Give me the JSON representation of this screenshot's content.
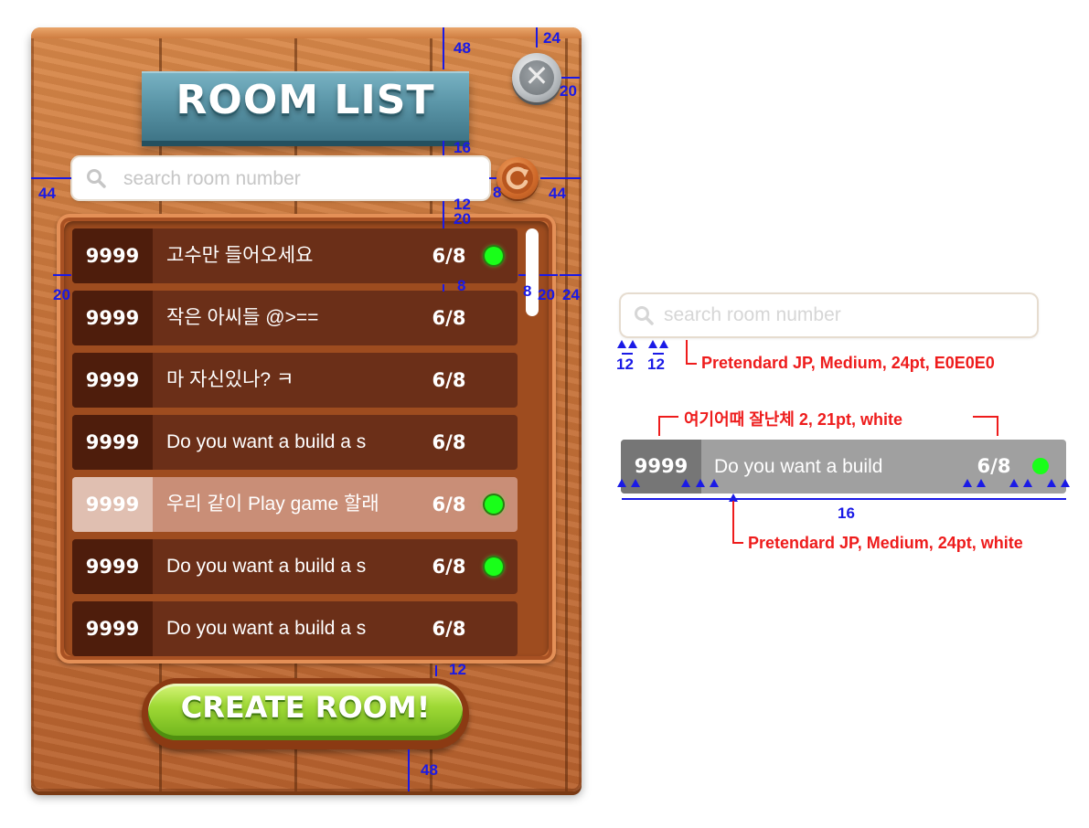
{
  "title": "ROOM LIST",
  "search": {
    "placeholder": "search room number",
    "value": ""
  },
  "rooms": [
    {
      "number": "9999",
      "name": "고수만 들어오세요",
      "count": "6/8",
      "online": true,
      "selected": false
    },
    {
      "number": "9999",
      "name": "작은 아씨들 @>==",
      "count": "6/8",
      "online": false,
      "selected": false
    },
    {
      "number": "9999",
      "name": "마 자신있나? ㅋ",
      "count": "6/8",
      "online": false,
      "selected": false
    },
    {
      "number": "9999",
      "name": "Do you want a build a s",
      "count": "6/8",
      "online": false,
      "selected": false
    },
    {
      "number": "9999",
      "name": "우리 같이 Play game 할래",
      "count": "6/8",
      "online": true,
      "selected": true
    },
    {
      "number": "9999",
      "name": "Do you want a build a s",
      "count": "6/8",
      "online": true,
      "selected": false
    },
    {
      "number": "9999",
      "name": "Do you  want a build a s",
      "count": "6/8",
      "online": false,
      "selected": false
    }
  ],
  "create_button": "CREATE ROOM!",
  "annotations": {
    "dims": [
      "48",
      "24",
      "20",
      "16",
      "44",
      "8",
      "44",
      "12",
      "20",
      "20",
      "8",
      "8",
      "20",
      "24",
      "12",
      "48"
    ],
    "spec_search": {
      "placeholder": "search room number",
      "dim_a": "12",
      "dim_b": "12",
      "font_note": "Pretendard JP, Medium, 24pt, E0E0E0"
    },
    "spec_row": {
      "number": "9999",
      "name": "Do you want a build",
      "count": "6/8",
      "number_font_note": "여기어때 잘난체 2, 21pt, white",
      "name_font_note": "Pretendard JP, Medium, 24pt, white",
      "spacing": "16"
    }
  },
  "colors": {
    "wood": "#c8743a",
    "row_bg": "#6b2f18",
    "row_selected_bg": "#c98e77",
    "online_dot": "#19ff19",
    "annotation_blue": "#1a1ae6",
    "annotation_red": "#ee1c1c"
  }
}
